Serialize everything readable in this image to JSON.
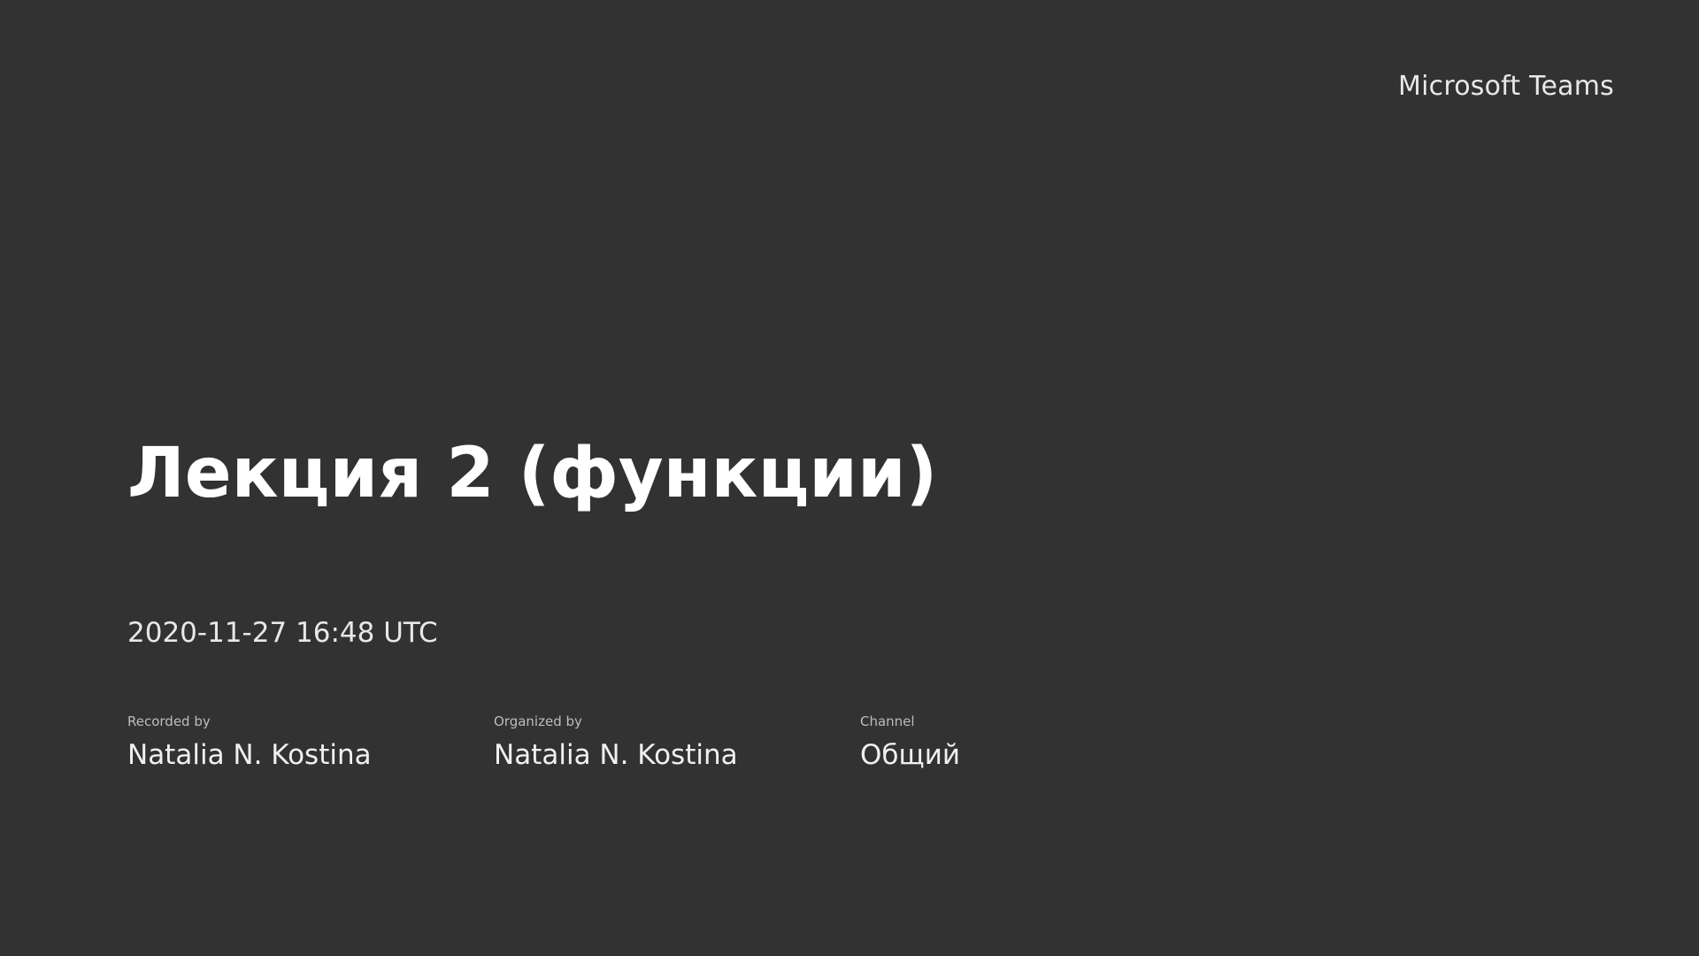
{
  "brand": {
    "name": "Microsoft Teams"
  },
  "recording": {
    "title": "Лекция 2 (функции)",
    "datetime": "2020-11-27 16:48 UTC",
    "details": [
      {
        "label": "Recorded by",
        "value": "Natalia N. Kostina"
      },
      {
        "label": "Organized by",
        "value": "Natalia N. Kostina"
      },
      {
        "label": "Channel",
        "value": "Общий"
      }
    ]
  },
  "colors": {
    "background": "#323232",
    "text": "#ffffff"
  }
}
